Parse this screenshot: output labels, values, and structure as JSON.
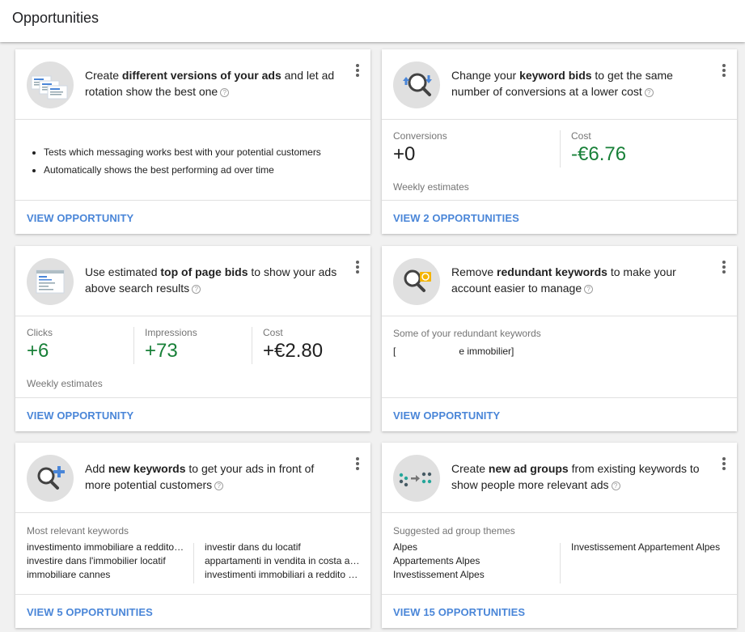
{
  "page": {
    "title": "Opportunities"
  },
  "cards": {
    "ad_versions": {
      "title_pre": "Create ",
      "title_bold": "different versions of your ads",
      "title_post": " and let ad rotation show the best one",
      "bullets": [
        "Tests which messaging works best with your potential customers",
        "Automatically shows the best performing ad over time"
      ],
      "link": "VIEW OPPORTUNITY"
    },
    "keyword_bids": {
      "title_pre": "Change your ",
      "title_bold": "keyword bids",
      "title_post": " to get the same number of conversions at a lower cost",
      "stats": [
        {
          "label": "Conversions",
          "value": "+0"
        },
        {
          "label": "Cost",
          "value": "-€6.76"
        }
      ],
      "note": "Weekly estimates",
      "link": "VIEW 2 OPPORTUNITIES"
    },
    "top_page_bids": {
      "title_pre": "Use estimated ",
      "title_bold": "top of page bids",
      "title_post": " to show your ads above search results",
      "stats": [
        {
          "label": "Clicks",
          "value": "+6"
        },
        {
          "label": "Impressions",
          "value": "+73"
        },
        {
          "label": "Cost",
          "value": "+€2.80"
        }
      ],
      "note": "Weekly estimates",
      "link": "VIEW OPPORTUNITY"
    },
    "redundant_keywords": {
      "title_pre": "Remove ",
      "title_bold": "redundant keywords",
      "title_post": " to make your account easier to manage",
      "label": "Some of your redundant keywords",
      "keyword_open": "[",
      "keyword_close": "e immobilier]",
      "link": "VIEW OPPORTUNITY"
    },
    "new_keywords": {
      "title_pre": "Add ",
      "title_bold": "new keywords",
      "title_post": " to get your ads in front of more potential customers",
      "label": "Most relevant keywords",
      "col1": [
        "investimento immobiliare a reddito…",
        "investire dans l'immobilier locatif",
        "immobiliare cannes"
      ],
      "col2": [
        "investir dans du locatif",
        "appartamenti in vendita in costa az…",
        "investimenti immobiliari a reddito g…"
      ],
      "link": "VIEW 5 OPPORTUNITIES"
    },
    "ad_groups": {
      "title_pre": "Create ",
      "title_bold": "new ad groups",
      "title_post": " from existing keywords to show people more relevant ads",
      "label": "Suggested ad group themes",
      "col1": [
        "Alpes",
        "Appartements Alpes",
        "Investissement Alpes"
      ],
      "col2": [
        "Investissement Appartement Alpes"
      ],
      "link": "VIEW 15 OPPORTUNITIES"
    }
  },
  "colors": {
    "link": "#4a86d8",
    "positive": "#188038",
    "icon_bg": "#e0e0e0"
  }
}
